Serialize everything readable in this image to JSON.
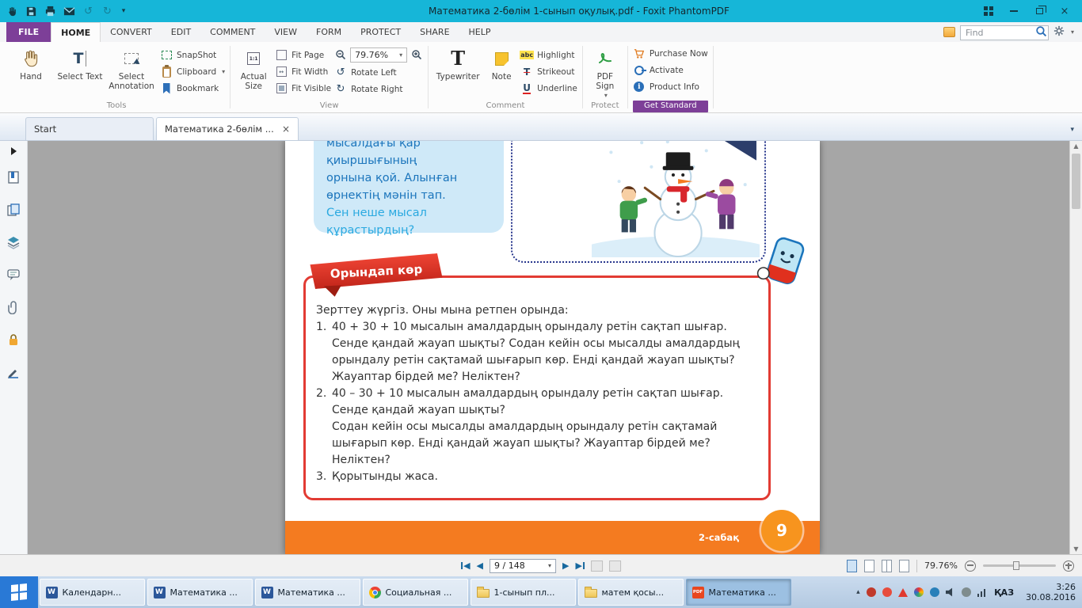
{
  "titlebar": {
    "title": "Математика 2-бөлім 1-сынып оқулық.pdf - Foxit PhantomPDF"
  },
  "icons": {
    "dropdown": "▾",
    "close": "×",
    "undo": "↺",
    "redo": "↻",
    "rotate_left": "↺",
    "rotate_right": "↻",
    "prev": "◀",
    "next": "▶",
    "up": "▲",
    "down": "▼",
    "tray_expand": "▴",
    "letter_T": "T",
    "abc": "abc",
    "letter_u": "U",
    "one_to_one": "1:1",
    "fit_width_mark": "↔",
    "letter_i": "i",
    "word": "W",
    "pdf_badge": "PDF"
  },
  "ribbon": {
    "file_tab": "FILE",
    "tabs": [
      "HOME",
      "CONVERT",
      "EDIT",
      "COMMENT",
      "VIEW",
      "FORM",
      "PROTECT",
      "SHARE",
      "HELP"
    ],
    "find_placeholder": "Find",
    "hand": "Hand",
    "select_text": "Select Text",
    "select_annotation": "Select Annotation",
    "snapshot": "SnapShot",
    "clipboard": "Clipboard",
    "bookmark": "Bookmark",
    "tools_group": "Tools",
    "actual_size": "Actual Size",
    "fit_page": "Fit Page",
    "fit_width": "Fit Width",
    "fit_visible": "Fit Visible",
    "zoom_value": "79.76%",
    "rotate_left": "Rotate Left",
    "rotate_right": "Rotate Right",
    "view_group": "View",
    "typewriter": "Typewriter",
    "note": "Note",
    "highlight": "Highlight",
    "strikeout": "Strikeout",
    "underline": "Underline",
    "comment_group": "Comment",
    "pdf_sign": "PDF Sign",
    "protect_group": "Protect",
    "purchase_now": "Purchase Now",
    "activate": "Activate",
    "product_info": "Product Info",
    "get_standard_group": "Get Standard"
  },
  "doc_tabs": {
    "start": "Start",
    "current": "Математика 2-бөлім ..."
  },
  "pdf": {
    "blue_box_text": "мысалдағы қар қиыршығының\nорнына қой. Алынған\nөрнектің мәнін тап.",
    "blue_box_question": "Сен неше мысал\nқұрастырдың?",
    "task_banner": "Орындап көр",
    "task_intro": "Зерттеу жүргіз. Оны мына ретпен орында:",
    "items": [
      {
        "num": "1.",
        "text": "40 + 30 + 10 мысалын амалдардың орындалу ретін сақтап шығар.\nСенде қандай жауап шықты? Содан кейін осы мысалды амалдардың\nорындалу ретін сақтамай шығарып көр. Енді қандай жауап шықты?\nЖауаптар бірдей ме? Неліктен?"
      },
      {
        "num": "2.",
        "text": "40 – 30 + 10 мысалын амалдардың орындалу ретін сақтап шығар.\nСенде қандай жауап шықты?\nСодан кейін осы мысалды амалдардың орындалу ретін сақтамай\nшығарып көр. Енді қандай жауап шықты? Жауаптар бірдей ме? Неліктен?"
      },
      {
        "num": "3.",
        "text": "Қорытынды жаса."
      }
    ],
    "footer_lesson": "2-сабақ",
    "page_number": "9"
  },
  "statusbar": {
    "page_indicator": "9 / 148",
    "zoom_percent": "79.76%"
  },
  "taskbar": {
    "items": [
      {
        "label": "Календарн..."
      },
      {
        "label": "Математика ..."
      },
      {
        "label": "Математика ..."
      },
      {
        "label": "Социальная ..."
      },
      {
        "label": "1-сынып пл..."
      },
      {
        "label": "матем қосы..."
      },
      {
        "label": "Математика ..."
      }
    ],
    "language": "ҚАЗ",
    "time": "3:26",
    "date": "30.08.2016"
  }
}
